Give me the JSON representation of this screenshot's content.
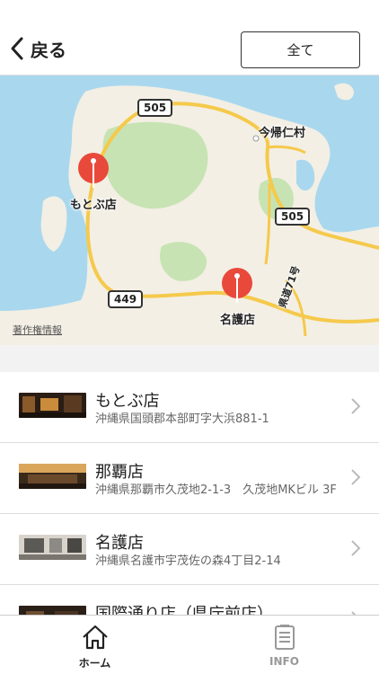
{
  "header": {
    "back_label": "戻る",
    "all_button_label": "全て"
  },
  "map": {
    "route_shields": [
      "505",
      "505",
      "449"
    ],
    "place_label": "今帰仁村",
    "road_label": "県道71号",
    "pins": [
      {
        "label": "もとぶ店",
        "color": "#e8493b"
      },
      {
        "label": "名護店",
        "color": "#e8493b"
      }
    ],
    "copyright": "著作権情報"
  },
  "stores": [
    {
      "name": "もとぶ店",
      "address": "沖縄県国頭郡本部町字大浜881-1"
    },
    {
      "name": "那覇店",
      "address": "沖縄県那覇市久茂地2-1-3　久茂地MKビル 3F"
    },
    {
      "name": "名護店",
      "address": "沖縄県名護市宇茂佐の森4丁目2-14"
    },
    {
      "name": "国際通り店（県庁前店）",
      "address": ""
    }
  ],
  "tabbar": {
    "home_label": "ホーム",
    "info_label": "INFO"
  },
  "colors": {
    "pin": "#e8493b",
    "sea": "#a9d8ee",
    "land": "#f3efe4",
    "road": "#f5c94b"
  }
}
